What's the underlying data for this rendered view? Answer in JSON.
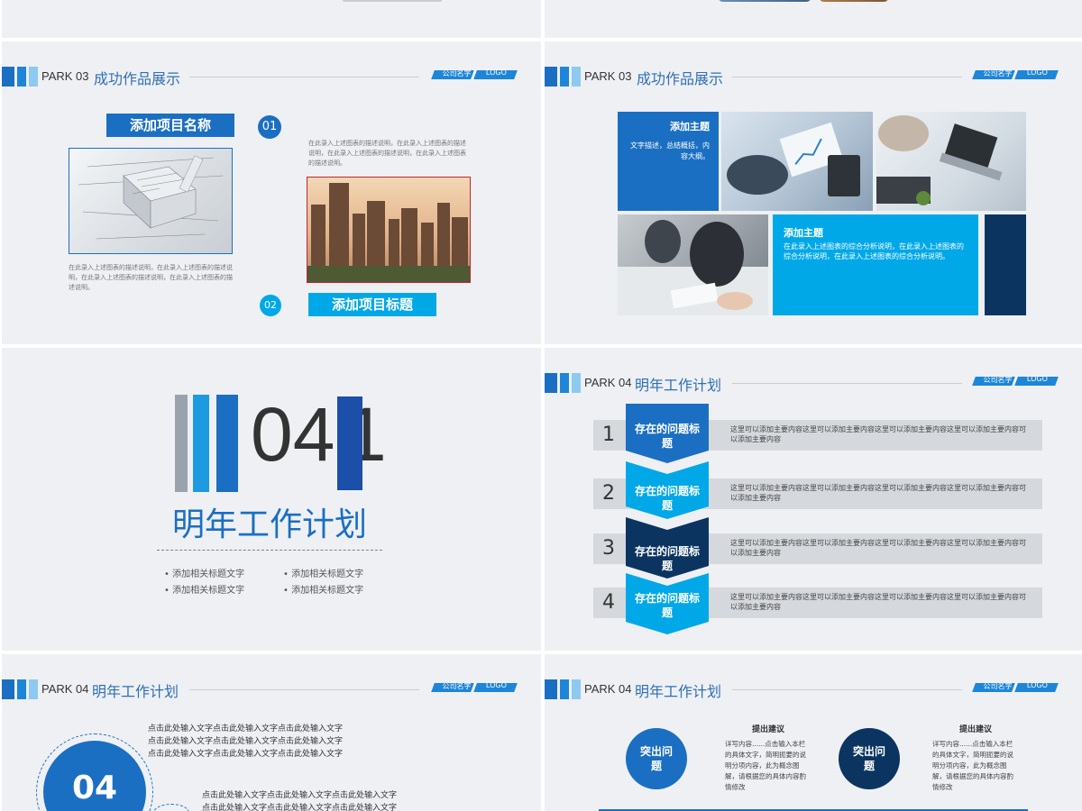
{
  "header": {
    "company_logo": "公司名字",
    "logo": "LOGO",
    "park03": "PARK 03",
    "park04": "PARK 04",
    "title03": "成功作品展示",
    "title04": "明年工作计划"
  },
  "slide3a": {
    "project_name": "添加项目名称",
    "num1": "01",
    "num2": "02",
    "project_title": "添加项目标题",
    "desc_right": "在此录入上述图表的描述说明，在此录入上述图表的描述说明，在此录入上述图表的描述说明，在此录入上述图表的描述说明。",
    "desc_left": "在此录入上述图表的描述说明，在此录入上述图表的描述说明，在此录入上述图表的描述说明，在此录入上述图表的描述说明。"
  },
  "slide3b": {
    "topic1": "添加主题",
    "topic1_text": "文字描述，总结概括，内容大纲。",
    "topic2": "添加主题",
    "topic2_text": "在此录入上述图表的综合分析说明，在此录入上述图表的综合分析说明，在此录入上述图表的综合分析说明。"
  },
  "section04": {
    "number": "04",
    "ghost": "1",
    "title": "明年工作计划",
    "bullets": [
      "添加相关标题文字",
      "添加相关标题文字",
      "添加相关标题文字",
      "添加相关标题文字"
    ]
  },
  "plan_rows": [
    {
      "num": "1",
      "label": "存在的问题标题",
      "text": "这里可以添加主要内容这里可以添加主要内容这里可以添加主要内容这里可以添加主要内容可以添加主要内容"
    },
    {
      "num": "2",
      "label": "存在的问题标题",
      "text": "这里可以添加主要内容这里可以添加主要内容这里可以添加主要内容这里可以添加主要内容可以添加主要内容"
    },
    {
      "num": "3",
      "label": "存在的问题标题",
      "text": "这里可以添加主要内容这里可以添加主要内容这里可以添加主要内容这里可以添加主要内容可以添加主要内容"
    },
    {
      "num": "4",
      "label": "存在的问题标题",
      "text": "这里可以添加主要内容这里可以添加主要内容这里可以添加主要内容这里可以添加主要内容可以添加主要内容"
    }
  ],
  "slide5a": {
    "lines1": [
      "点击此处输入文字点击此处输入文字点击此处输入文字",
      "点击此处输入文字点击此处输入文字点击此处输入文字",
      "点击此处输入文字点击此处输入文字点击此处输入文字"
    ],
    "lines2": [
      "点击此处输入文字点击此处输入文字点击此处输入文字",
      "点击此处输入文字点击此处输入文字点击此处输入文字"
    ],
    "big_num": "04"
  },
  "slide5b": {
    "circle1": "突出问题",
    "circle2": "突出问题",
    "head1": "提出建议",
    "head2": "提出建议",
    "text1": "详写内容......点击输入本栏的具体文字，简明扼要的说明分项内容，此为概念图解，请根据您的具体内容酌情修改",
    "text2": "详写内容......点击输入本栏的具体文字，简明扼要的说明分项内容，此为概念图解，请根据您的具体内容酌情修改"
  },
  "colors": {
    "blue": "#1b6fc2",
    "sky": "#00a8e8",
    "navy": "#0b3560",
    "bg": "#eef0f4"
  }
}
